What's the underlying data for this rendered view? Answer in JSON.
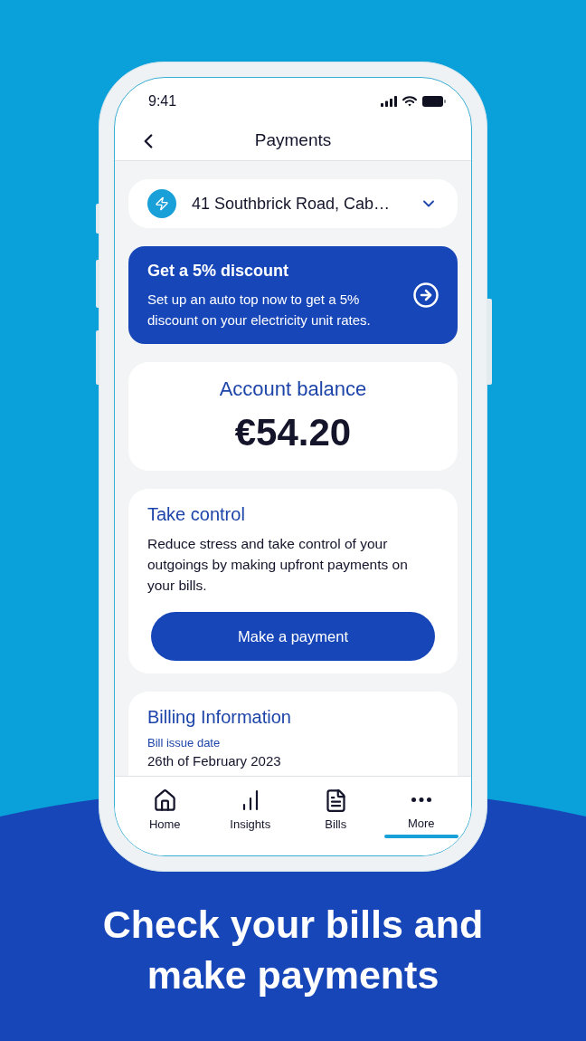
{
  "status_bar": {
    "time": "9:41"
  },
  "header": {
    "title": "Payments"
  },
  "account_selector": {
    "address": "41 Southbrick Road, Cab…"
  },
  "promo_card": {
    "title": "Get a 5% discount",
    "text": "Set up an auto top now to get a 5% discount on your electricity unit rates."
  },
  "balance_card": {
    "label": "Account balance",
    "amount": "€54.20"
  },
  "take_control_card": {
    "title": "Take control",
    "text": "Reduce stress and take control of your outgoings by making upfront payments on your bills.",
    "button": "Make a payment"
  },
  "billing_card": {
    "title": "Billing Information",
    "fields": [
      {
        "label": "Bill issue date",
        "value": "26th of February 2023"
      }
    ]
  },
  "tab_bar": {
    "tabs": [
      {
        "label": "Home",
        "selected": false
      },
      {
        "label": "Insights",
        "selected": false
      },
      {
        "label": "Bills",
        "selected": false
      },
      {
        "label": "More",
        "selected": true
      }
    ]
  },
  "headline": "Check your bills and make payments"
}
